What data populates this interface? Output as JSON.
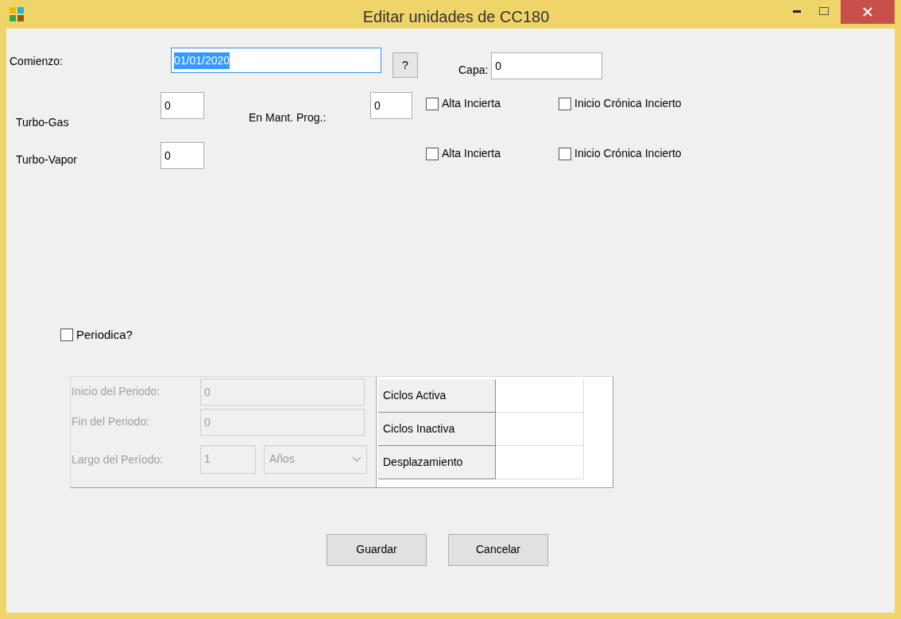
{
  "window": {
    "title": "Editar unidades de CC180"
  },
  "start": {
    "label": "Comienzo:",
    "value": "01/01/2020",
    "text_selected": true
  },
  "help_button": "?",
  "layer": {
    "label": "Capa:",
    "value": "0"
  },
  "unit_fields": [
    {
      "label": "Turbo-Gas",
      "value": "0"
    },
    {
      "label": "Turbo-Vapor",
      "value": "0"
    }
  ],
  "maintenance": {
    "label": "En Mant. Prog.:",
    "value": "0"
  },
  "checkbox_rows": [
    {
      "items": [
        {
          "label": "Alta Incierta",
          "checked": false
        },
        {
          "label": "Inicio Crónica Incierto",
          "checked": false
        }
      ]
    },
    {
      "items": [
        {
          "label": "Alta Incierta",
          "checked": false
        },
        {
          "label": "Inicio Crónica Incierto",
          "checked": false
        }
      ]
    }
  ],
  "periodic": {
    "label": "Periodica?",
    "checked": false
  },
  "period_panel": {
    "disabled": true,
    "fields": [
      {
        "label": "Inicio del Periodo:",
        "value": "0"
      },
      {
        "label": "Fin del Periodo:",
        "value": "0"
      }
    ],
    "length": {
      "label": "Largo del Período:",
      "value": "1",
      "unit": "Años"
    }
  },
  "cycles_grid": {
    "rows": [
      {
        "header": "Ciclos Activa"
      },
      {
        "header": "Ciclos Inactiva"
      },
      {
        "header": "Desplazamiento"
      }
    ]
  },
  "buttons": [
    "Guardar",
    "Cancelar"
  ]
}
